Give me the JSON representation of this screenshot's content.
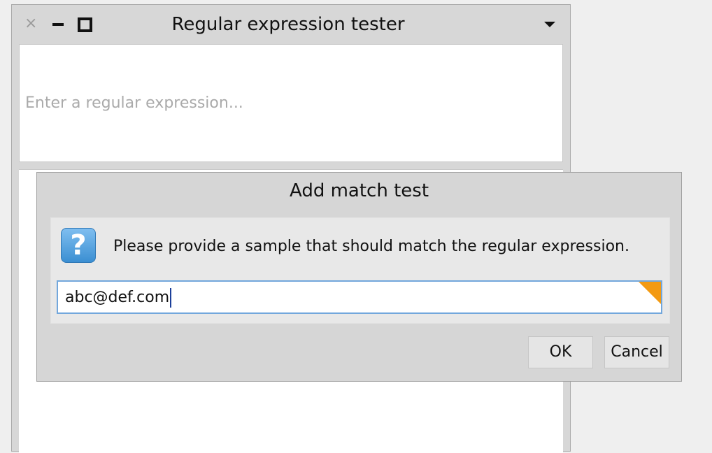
{
  "window": {
    "title": "Regular expression tester",
    "close_icon": "close-icon",
    "minimize_icon": "minimize-icon",
    "maximize_icon": "maximize-icon",
    "menu_icon": "chevron-down-icon"
  },
  "regex_input": {
    "placeholder": "Enter a regular expression...",
    "value": ""
  },
  "dialog": {
    "title": "Add match test",
    "icon": "question-icon",
    "prompt": "Please provide a sample that should match the regular expression.",
    "sample_value": "abc@def.com",
    "ok_label": "OK",
    "cancel_label": "Cancel",
    "field_flag_color": "#f39a12"
  }
}
